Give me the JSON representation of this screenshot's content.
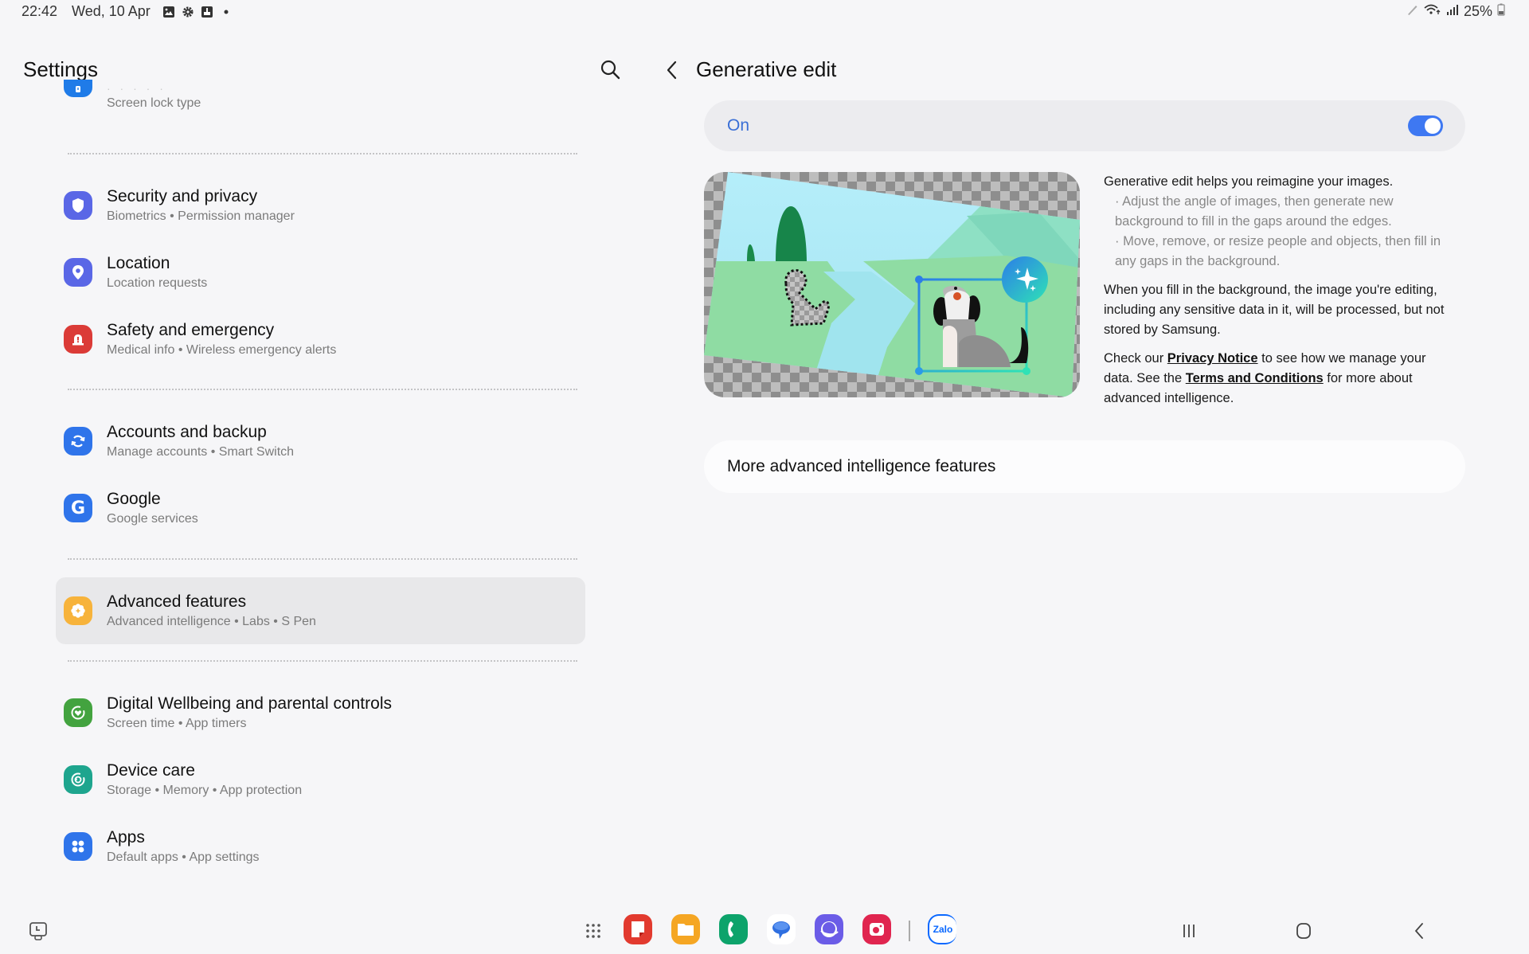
{
  "status_bar": {
    "time": "22:42",
    "date": "Wed, 10 Apr",
    "notification_icons": [
      "gallery-icon",
      "settings-gear-icon",
      "screenshot-icon",
      "more-dot-icon"
    ],
    "battery": "25%",
    "right_icons": [
      "s-pen-icon",
      "wifi-icon",
      "signal-icon",
      "battery-charging-icon"
    ]
  },
  "left_panel": {
    "title": "Settings",
    "search_icon": "search-icon",
    "items": [
      {
        "title": "· · · · ·",
        "subtitle": "Screen lock type",
        "icon": "lock-icon",
        "color": "#1f7be8"
      },
      {
        "title": "Security and privacy",
        "subtitle": "Biometrics  •  Permission manager",
        "icon": "shield-icon",
        "color": "#5a67e6"
      },
      {
        "title": "Location",
        "subtitle": "Location requests",
        "icon": "location-pin-icon",
        "color": "#5a67e6"
      },
      {
        "title": "Safety and emergency",
        "subtitle": "Medical info  •  Wireless emergency alerts",
        "icon": "emergency-siren-icon",
        "color": "#db3b37"
      },
      {
        "title": "Accounts and backup",
        "subtitle": "Manage accounts  •  Smart Switch",
        "icon": "sync-icon",
        "color": "#2f74ea"
      },
      {
        "title": "Google",
        "subtitle": "Google services",
        "icon": "google-g-icon",
        "color": "#2f74ea"
      },
      {
        "title": "Advanced features",
        "subtitle": "Advanced intelligence  •  Labs  •  S Pen",
        "icon": "advanced-features-gear-icon",
        "color": "#f7b33b",
        "selected": true
      },
      {
        "title": "Digital Wellbeing and parental controls",
        "subtitle": "Screen time  •  App timers",
        "icon": "wellbeing-heart-icon",
        "color": "#43a33f"
      },
      {
        "title": "Device care",
        "subtitle": "Storage  •  Memory  •  App protection",
        "icon": "device-care-icon",
        "color": "#1ea58e"
      },
      {
        "title": "Apps",
        "subtitle": "Default apps  •  App settings",
        "icon": "apps-grid-icon",
        "color": "#2f74ea"
      }
    ]
  },
  "right_panel": {
    "title": "Generative edit",
    "back_icon": "back-chevron-icon",
    "switch": {
      "label": "On",
      "state": true,
      "accent": "#3e78f2"
    },
    "illustration_alt": "Dog photo being edited with generative fill",
    "description": {
      "intro": "Generative edit helps you reimagine your images.",
      "bullets": [
        "· Adjust the angle of images, then generate new background to fill in the gaps around the edges.",
        "· Move, remove, or resize people and objects, then fill in any gaps in the background."
      ],
      "privacy_paragraph": "When you fill in the background, the image you're editing, including any sensitive data in it, will be processed, but not stored by Samsung.",
      "links_paragraph": {
        "part1": "Check our ",
        "link1": "Privacy Notice",
        "part2": " to see how we manage your data. See the ",
        "link2": "Terms and Conditions",
        "part3": " for more about advanced intelligence."
      }
    },
    "more_card_label": "More advanced intelligence features"
  },
  "nav_bar": {
    "left_icon": "screen-time-clock-icon",
    "dock_apps": [
      {
        "name": "app-drawer",
        "icon": "app-drawer-grid-icon"
      },
      {
        "name": "samsung-notes",
        "icon": "notes-icon",
        "color": "#e23a2f"
      },
      {
        "name": "my-files",
        "icon": "folder-icon",
        "color": "#f5a623"
      },
      {
        "name": "phone",
        "icon": "phone-icon",
        "color": "#0da36b"
      },
      {
        "name": "messages",
        "icon": "chat-bubble-icon",
        "color": "#3b7be8"
      },
      {
        "name": "samsung-internet",
        "icon": "internet-planet-icon",
        "color": "#6b5ce7"
      },
      {
        "name": "camera",
        "icon": "camera-icon",
        "color": "#e0254f"
      },
      {
        "name": "zalo",
        "icon": "zalo-icon",
        "label": "Zalo",
        "color": "#0a68ff"
      }
    ],
    "system_buttons": [
      "recents-icon",
      "home-icon",
      "back-icon"
    ]
  }
}
